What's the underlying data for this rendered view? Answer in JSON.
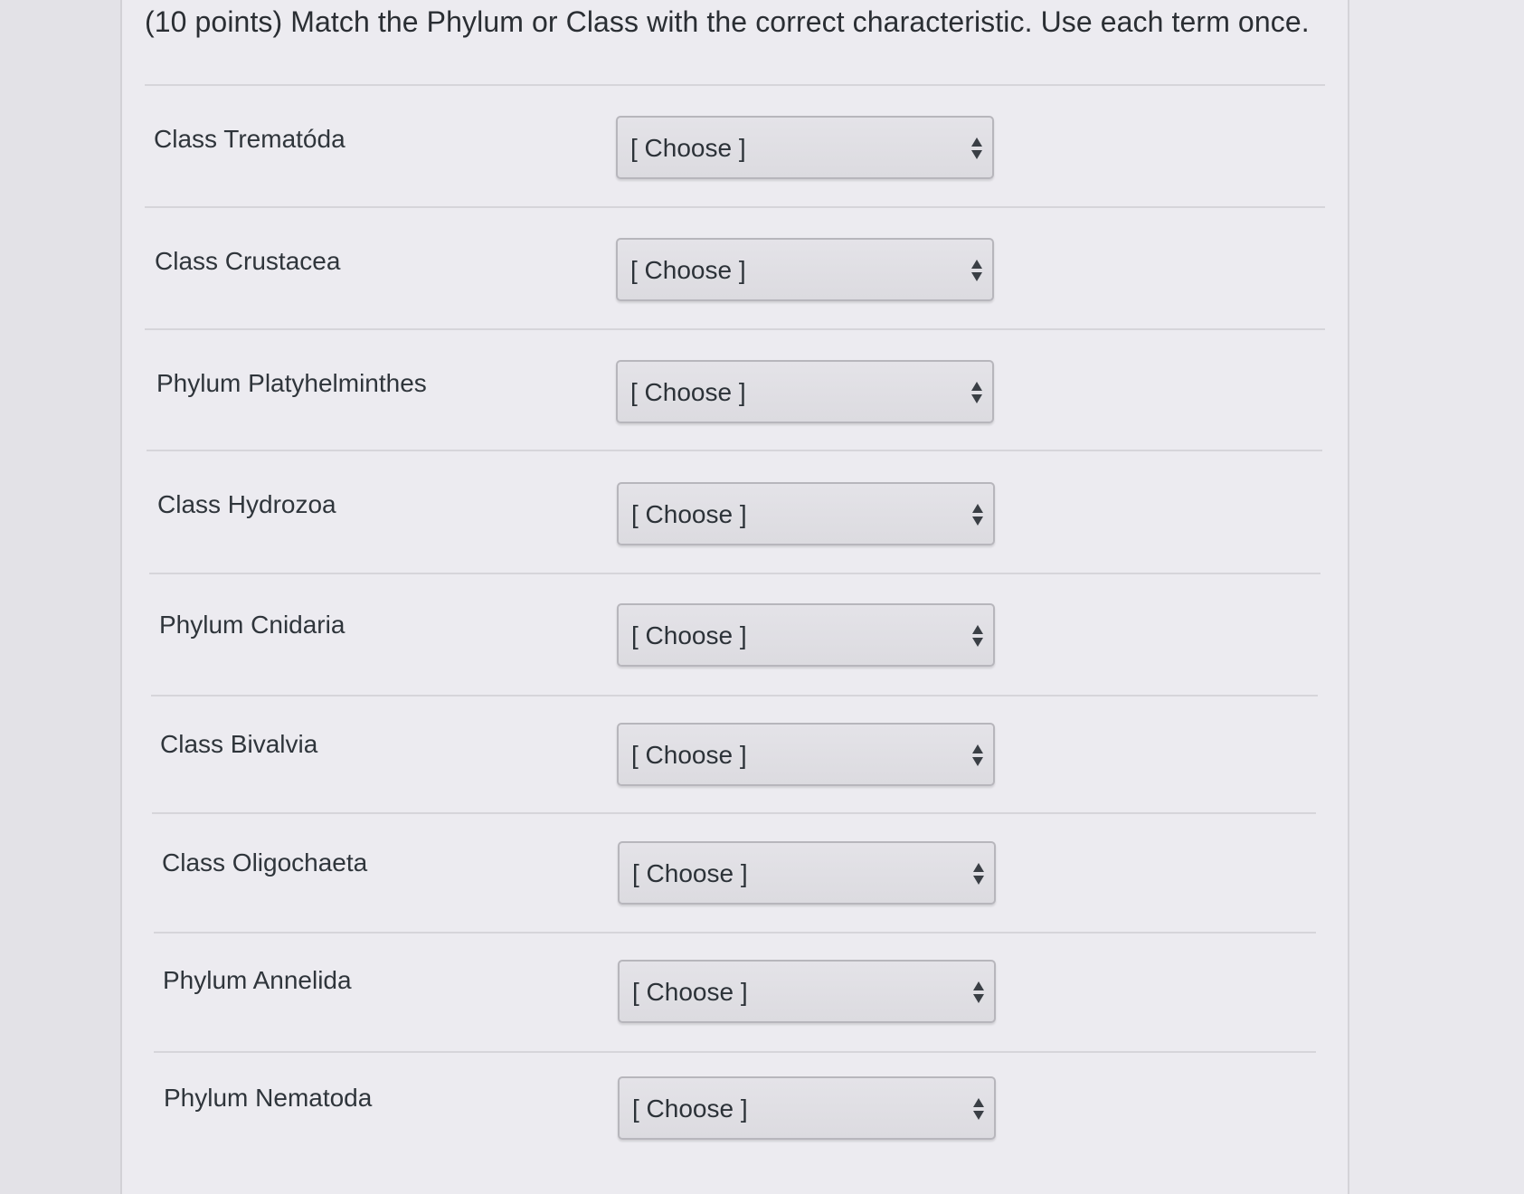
{
  "question": {
    "text": "(10 points) Match the Phylum or Class with the correct characteristic. Use each term once."
  },
  "rows": [
    {
      "term": "Class Trematóda",
      "selected": "[ Choose ]"
    },
    {
      "term": "Class Crustacea",
      "selected": "[ Choose ]"
    },
    {
      "term": "Phylum Platyhelminthes",
      "selected": "[ Choose ]"
    },
    {
      "term": "Class Hydrozoa",
      "selected": "[ Choose ]"
    },
    {
      "term": "Phylum Cnidaria",
      "selected": "[ Choose ]"
    },
    {
      "term": "Class Bivalvia",
      "selected": "[ Choose ]"
    },
    {
      "term": "Class Oligochaeta",
      "selected": "[ Choose ]"
    },
    {
      "term": "Phylum Annelida",
      "selected": "[ Choose ]"
    },
    {
      "term": "Phylum Nematoda",
      "selected": "[ Choose ]"
    }
  ],
  "icons": {
    "select_arrow": "sort-arrows-icon"
  }
}
